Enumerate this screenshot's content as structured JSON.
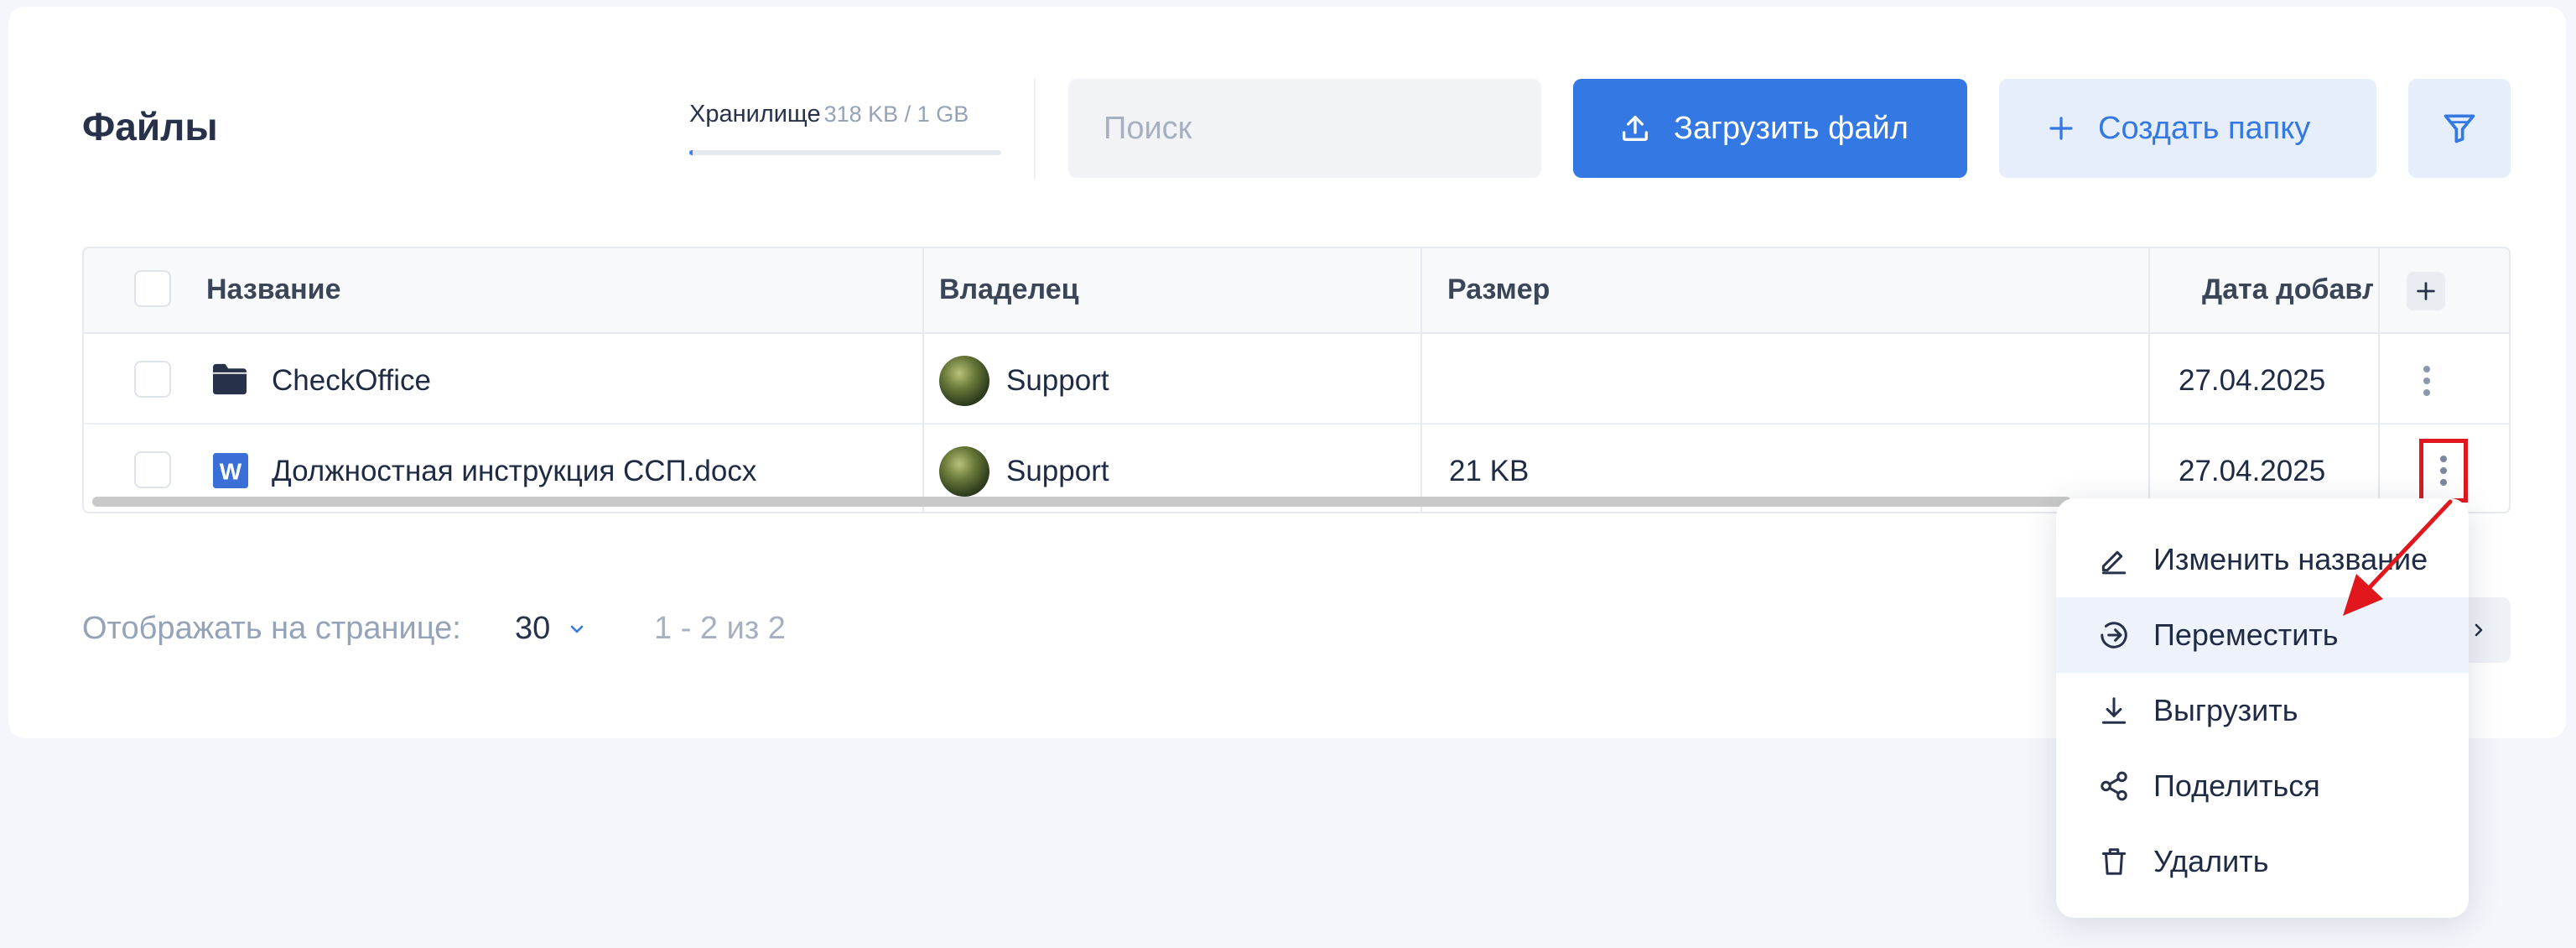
{
  "header": {
    "title": "Файлы",
    "storage_label": "Хранилище",
    "storage_used": "318 KB / 1 GB",
    "storage_fraction": 0.01,
    "search_placeholder": "Поиск",
    "upload_label": "Загрузить файл",
    "create_folder_label": "Создать папку"
  },
  "table": {
    "columns": [
      "Название",
      "Владелец",
      "Размер",
      "Дата добавления"
    ],
    "rows": [
      {
        "name": "CheckOffice",
        "type": "folder-icon",
        "owner": "Support",
        "size": "",
        "date": "27.04.2025"
      },
      {
        "name": "Должностная инструкция ССП.docx",
        "type": "word-doc-icon",
        "owner": "Support",
        "size": "21 KB",
        "date": "27.04.2025"
      }
    ]
  },
  "pagination": {
    "per_page_label": "Отображать на странице:",
    "per_page_value": "30",
    "range": "1 - 2 из 2"
  },
  "context_menu": {
    "items": [
      {
        "label": "Изменить название",
        "icon": "pencil-icon"
      },
      {
        "label": "Переместить",
        "icon": "move-icon"
      },
      {
        "label": "Выгрузить",
        "icon": "download-icon"
      },
      {
        "label": "Поделиться",
        "icon": "share-icon"
      },
      {
        "label": "Удалить",
        "icon": "trash-icon"
      }
    ],
    "hovered_index": 1
  },
  "colors": {
    "primary": "#3478e3",
    "primary_light": "#e5eefa",
    "annotation_red": "#e0181e"
  }
}
